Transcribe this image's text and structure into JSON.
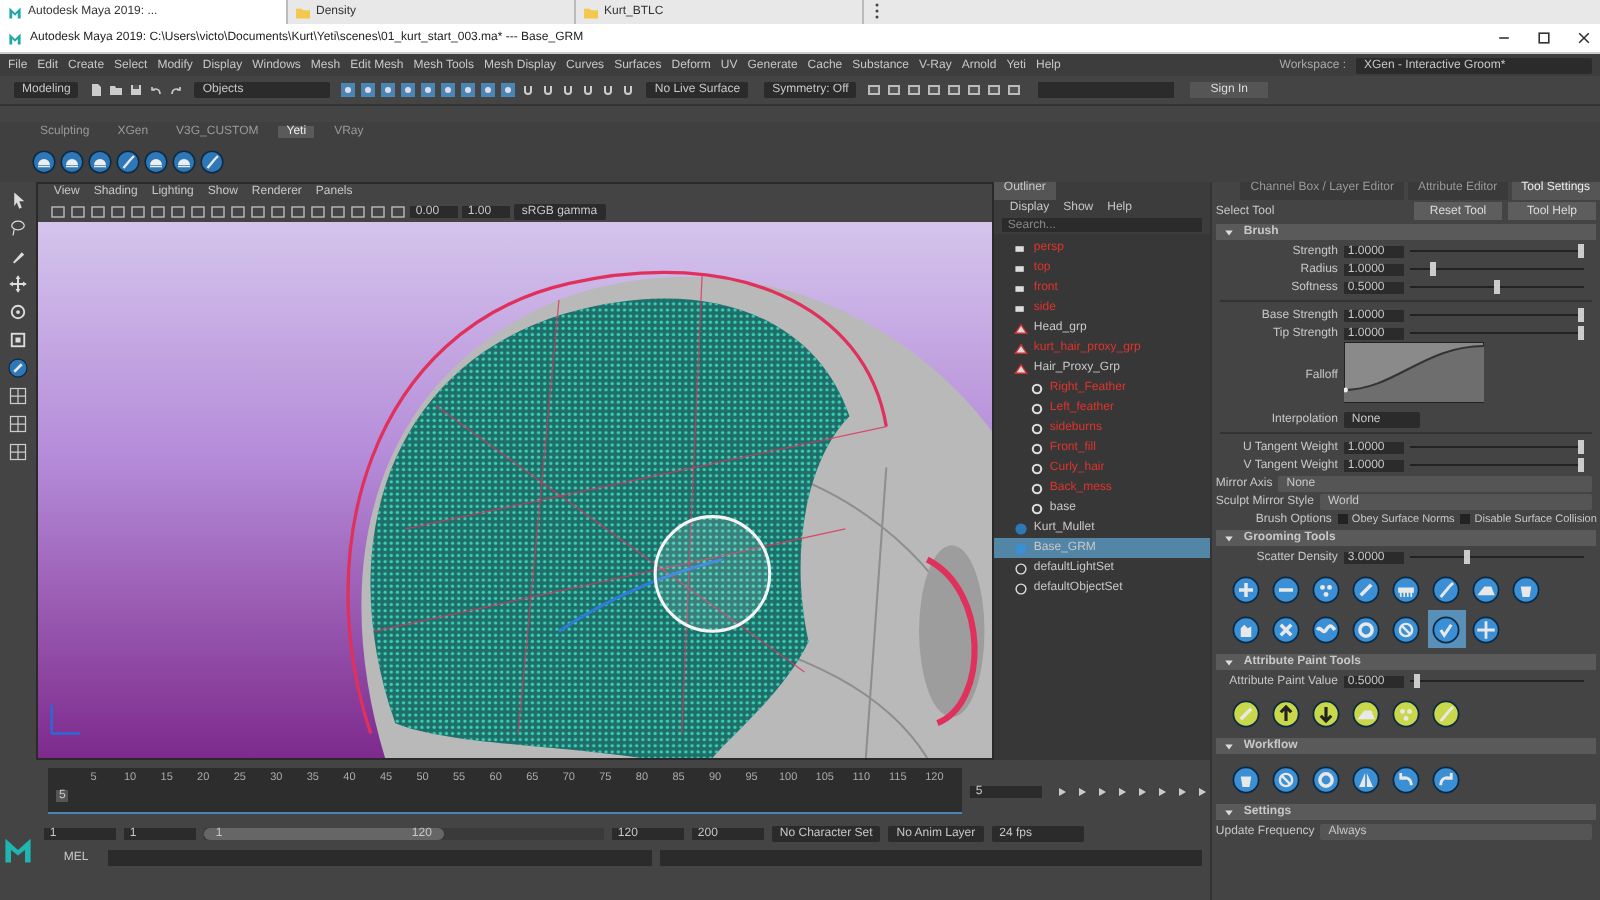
{
  "browser_tabs": [
    {
      "label": "Autodesk Maya 2019: ...",
      "kind": "app",
      "selected": true
    },
    {
      "label": "Density",
      "kind": "folder",
      "selected": false
    },
    {
      "label": "Kurt_BTLC",
      "kind": "folder",
      "selected": false
    }
  ],
  "window": {
    "title": "Autodesk Maya 2019: C:\\Users\\victo\\Documents\\Kurt\\Yeti\\scenes\\01_kurt_start_003.ma*  ---  Base_GRM"
  },
  "menu": [
    "File",
    "Edit",
    "Create",
    "Select",
    "Modify",
    "Display",
    "Windows",
    "Mesh",
    "Edit Mesh",
    "Mesh Tools",
    "Mesh Display",
    "Curves",
    "Surfaces",
    "Deform",
    "UV",
    "Generate",
    "Cache",
    "Substance",
    "V-Ray",
    "Arnold",
    "Yeti",
    "Help"
  ],
  "workspace": {
    "label": "Workspace :",
    "value": "XGen - Interactive Groom*"
  },
  "status_line": {
    "mode": "Modeling",
    "selection": "Objects",
    "live_surface": "No Live Surface",
    "symmetry": "Symmetry: Off",
    "sign_in": "Sign In"
  },
  "shelf": {
    "tabs": [
      {
        "label": "Sculpting",
        "selected": false
      },
      {
        "label": "XGen",
        "selected": false
      },
      {
        "label": "V3G_CUSTOM",
        "selected": false
      },
      {
        "label": "Yeti",
        "selected": true
      },
      {
        "label": "VRay",
        "selected": false
      }
    ]
  },
  "viewport": {
    "menu": [
      "View",
      "Shading",
      "Lighting",
      "Show",
      "Renderer",
      "Panels"
    ],
    "exposure": "0.00",
    "gamma": "1.00",
    "color_space": "sRGB gamma"
  },
  "outliner": {
    "title": "Outliner",
    "menu": [
      "Display",
      "Show",
      "Help"
    ],
    "search": {
      "placeholder": "Search..."
    },
    "items": [
      {
        "label": "persp",
        "kind": "camera",
        "color": "#e0342c",
        "selected": false
      },
      {
        "label": "top",
        "kind": "camera",
        "color": "#e0342c",
        "selected": false
      },
      {
        "label": "front",
        "kind": "camera",
        "color": "#e0342c",
        "selected": false
      },
      {
        "label": "side",
        "kind": "camera",
        "color": "#e0342c",
        "selected": false
      },
      {
        "label": "Head_grp",
        "kind": "group",
        "color": "#c8c8c8",
        "selected": false
      },
      {
        "label": "kurt_hair_proxy_grp",
        "kind": "group",
        "color": "#e0342c",
        "selected": false
      },
      {
        "label": "Hair_Proxy_Grp",
        "kind": "group",
        "color": "#c8c8c8",
        "selected": false,
        "children": [
          {
            "label": "Right_Feather",
            "kind": "curve",
            "color": "#e0342c",
            "selected": false
          },
          {
            "label": "Left_feather",
            "kind": "curve",
            "color": "#e0342c",
            "selected": false
          },
          {
            "label": "sideburns",
            "kind": "curve",
            "color": "#e0342c",
            "selected": false
          },
          {
            "label": "Front_fill",
            "kind": "curve",
            "color": "#e0342c",
            "selected": false
          },
          {
            "label": "Curly_hair",
            "kind": "curve",
            "color": "#e0342c",
            "selected": false
          },
          {
            "label": "Back_mess",
            "kind": "curve",
            "color": "#e0342c",
            "selected": false
          },
          {
            "label": "base",
            "kind": "curve",
            "color": "#c8c8c8",
            "selected": false
          }
        ]
      },
      {
        "label": "Kurt_Mullet",
        "kind": "yeti",
        "color": "#c8c8c8",
        "selected": false
      },
      {
        "label": "Base_GRM",
        "kind": "groom",
        "color": "#c8c8c8",
        "selected": true
      },
      {
        "label": "defaultLightSet",
        "kind": "set",
        "color": "#c8c8c8",
        "selected": false
      },
      {
        "label": "defaultObjectSet",
        "kind": "set",
        "color": "#c8c8c8",
        "selected": false
      }
    ]
  },
  "tool_settings": {
    "tabs": [
      {
        "label": "Channel Box / Layer Editor",
        "selected": false
      },
      {
        "label": "Attribute Editor",
        "selected": false
      },
      {
        "label": "Tool Settings",
        "selected": true
      }
    ],
    "tool_name": "Select Tool",
    "buttons": [
      "Reset Tool",
      "Tool Help"
    ],
    "sections": [
      {
        "title": "Brush",
        "expanded": true,
        "rows": [
          {
            "kind": "slider",
            "label": "Strength",
            "value": "1.0000",
            "level": 1
          },
          {
            "kind": "slider",
            "label": "Radius",
            "value": "1.0000",
            "level": 0.12
          },
          {
            "kind": "slider",
            "label": "Softness",
            "value": "0.5000",
            "level": 0.5
          },
          {
            "kind": "rule"
          },
          {
            "kind": "slider",
            "label": "Base Strength",
            "value": "1.0000",
            "level": 1
          },
          {
            "kind": "slider",
            "label": "Tip Strength",
            "value": "1.0000",
            "level": 1
          },
          {
            "kind": "curve",
            "label": "Falloff"
          },
          {
            "kind": "dropdown",
            "label": "Interpolation",
            "value": "None"
          },
          {
            "kind": "rule"
          },
          {
            "kind": "slider",
            "label": "U Tangent Weight",
            "value": "1.0000",
            "level": 1
          },
          {
            "kind": "slider",
            "label": "V Tangent Weight",
            "value": "1.0000",
            "level": 1
          },
          {
            "kind": "wide",
            "label": "Mirror Axis",
            "value": "None"
          },
          {
            "kind": "wide",
            "label": "Sculpt Mirror Style",
            "value": "World"
          },
          {
            "kind": "checks",
            "label": "Brush Options",
            "options": [
              {
                "label": "Obey Surface Norms",
                "checked": false
              },
              {
                "label": "Disable Surface Collision",
                "checked": false
              }
            ]
          }
        ]
      },
      {
        "title": "Grooming Tools",
        "expanded": true,
        "rows": [
          {
            "kind": "slider",
            "label": "Scatter Density",
            "value": "3.0000",
            "level": 0.32
          },
          {
            "kind": "icons",
            "icons": [
              {
                "selected": false
              },
              {
                "selected": false
              },
              {
                "selected": false
              },
              {
                "selected": false
              },
              {
                "selected": false
              },
              {
                "selected": false
              },
              {
                "selected": false
              },
              {
                "selected": false
              },
              {
                "selected": false
              },
              {
                "selected": false
              },
              {
                "selected": false
              },
              {
                "selected": false
              },
              {
                "selected": false
              },
              {
                "selected": true
              },
              {
                "selected": false
              }
            ]
          }
        ]
      },
      {
        "title": "Attribute Paint Tools",
        "expanded": true,
        "rows": [
          {
            "kind": "slider",
            "label": "Attribute Paint Value",
            "value": "0.5000",
            "level": 0.02
          },
          {
            "kind": "icons",
            "icons": [
              {
                "selected": false
              },
              {
                "selected": false
              },
              {
                "selected": false
              },
              {
                "selected": false
              },
              {
                "selected": false
              },
              {
                "selected": false
              }
            ]
          }
        ]
      },
      {
        "title": "Workflow",
        "expanded": true,
        "rows": [
          {
            "kind": "icons",
            "icons": [
              {
                "selected": false
              },
              {
                "selected": false
              },
              {
                "selected": false
              },
              {
                "selected": false
              },
              {
                "selected": false
              },
              {
                "selected": false
              }
            ]
          }
        ]
      },
      {
        "title": "Settings",
        "expanded": true,
        "rows": [
          {
            "kind": "wide",
            "label": "Update Frequency",
            "value": "Always"
          }
        ]
      }
    ]
  },
  "timeline": {
    "ticks": [
      "5",
      "10",
      "15",
      "20",
      "25",
      "30",
      "35",
      "40",
      "45",
      "50",
      "55",
      "60",
      "65",
      "70",
      "75",
      "80",
      "85",
      "90",
      "95",
      "100",
      "105",
      "110",
      "115",
      "120"
    ],
    "current": "5",
    "level": 0,
    "frame_field": "5"
  },
  "range": {
    "level": 0.6,
    "start": "1",
    "playback_start": "1",
    "range_start": "1",
    "range_end": "120",
    "playback_end": "120",
    "end": "200",
    "character_set": "No Character Set",
    "anim_layer": "No Anim Layer",
    "fps": "24 fps"
  },
  "command_line": {
    "label": "MEL"
  }
}
